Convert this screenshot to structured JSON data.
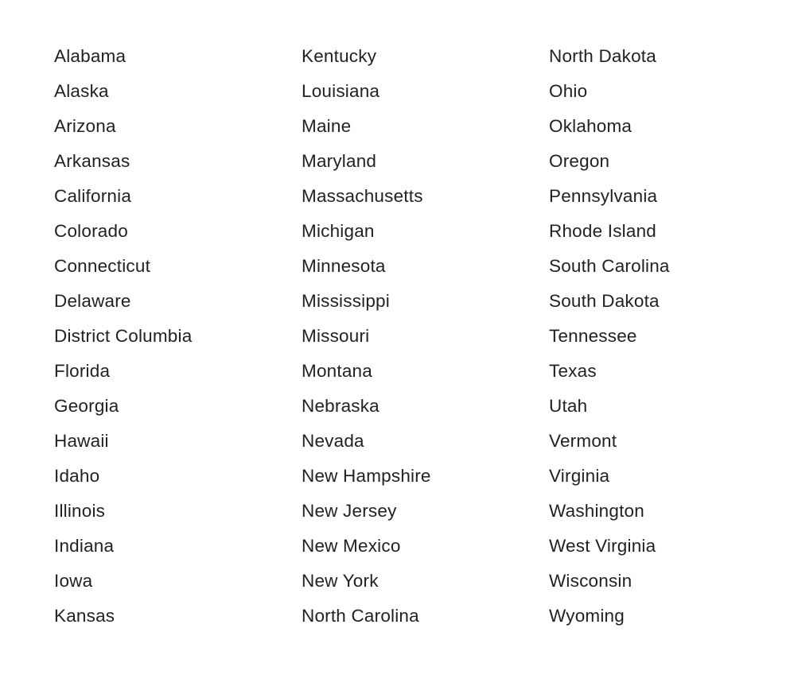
{
  "columns": [
    {
      "items": [
        "Alabama",
        "Alaska",
        "Arizona",
        "Arkansas",
        "California",
        "Colorado",
        "Connecticut",
        "Delaware",
        "District Columbia",
        "Florida",
        "Georgia",
        "Hawaii",
        "Idaho",
        "Illinois",
        "Indiana",
        "Iowa",
        "Kansas"
      ]
    },
    {
      "items": [
        "Kentucky",
        "Louisiana",
        "Maine",
        "Maryland",
        "Massachusetts",
        "Michigan",
        "Minnesota",
        "Mississippi",
        "Missouri",
        "Montana",
        "Nebraska",
        "Nevada",
        "New Hampshire",
        "New Jersey",
        "New Mexico",
        "New York",
        "North Carolina"
      ]
    },
    {
      "items": [
        "North Dakota",
        "Ohio",
        "Oklahoma",
        "Oregon",
        "Pennsylvania",
        "Rhode Island",
        "South Carolina",
        "South Dakota",
        "Tennessee",
        "Texas",
        "Utah",
        "Vermont",
        "Virginia",
        "Washington",
        "West Virginia",
        "Wisconsin",
        "Wyoming"
      ]
    }
  ]
}
